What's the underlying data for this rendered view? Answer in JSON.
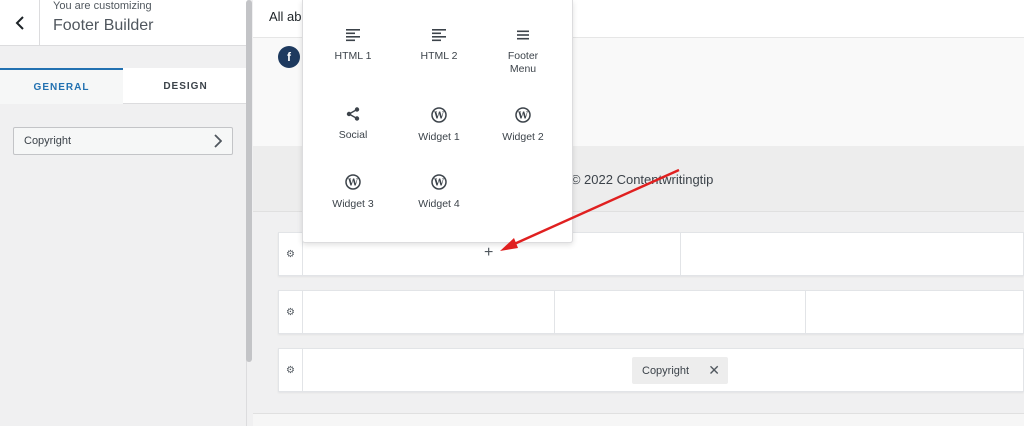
{
  "sidebar": {
    "subtitle": "You are customizing",
    "title": "Footer Builder",
    "tabs": [
      {
        "label": "GENERAL"
      },
      {
        "label": "DESIGN"
      }
    ],
    "items": [
      {
        "label": "Copyright"
      }
    ]
  },
  "preview": {
    "topbar_text": "All abo",
    "copyright_text": "opyright © 2022 Contentwritingtip",
    "row3_chip": "Copyright",
    "plus": "+"
  },
  "popup": {
    "items": [
      {
        "label": "HTML 1",
        "icon": "html-text-icon"
      },
      {
        "label": "HTML 2",
        "icon": "html-text-icon"
      },
      {
        "label": "Footer Menu",
        "icon": "menu-lines-icon"
      },
      {
        "label": "Social",
        "icon": "share-icon"
      },
      {
        "label": "Widget 1",
        "icon": "wordpress-icon"
      },
      {
        "label": "Widget 2",
        "icon": "wordpress-icon"
      },
      {
        "label": "Widget 3",
        "icon": "wordpress-icon"
      },
      {
        "label": "Widget 4",
        "icon": "wordpress-icon"
      }
    ]
  },
  "colors": {
    "accent": "#2271b1",
    "annotation_arrow": "#e02020",
    "facebook": "#1e3a5f"
  }
}
